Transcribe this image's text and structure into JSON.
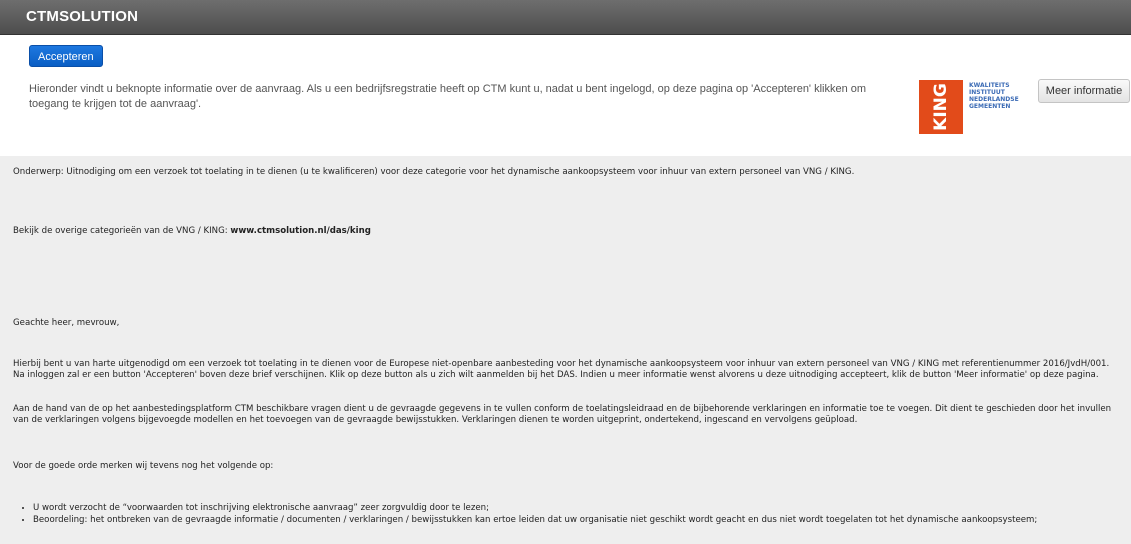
{
  "header": {
    "title": "CTMSOLUTION"
  },
  "toolbar": {
    "accept_label": "Accepteren",
    "more_info_label": "Meer informatie"
  },
  "intro_text": "Hieronder vindt u beknopte informatie over de aanvraag. Als u een bedrijfsregstratie heeft op CTM kunt u, nadat u bent ingelogd, op deze pagina op 'Accepteren' klikken om toegang te krijgen tot de aanvraag'.",
  "logo": {
    "letters": "KING",
    "lines": [
      "KWALITEITS",
      "INSTITUUT",
      "NEDERLANDSE",
      "GEMEENTEN"
    ],
    "color": "#e24b1a"
  },
  "letter": {
    "subject": "Onderwerp: Uitnodiging om een verzoek tot toelating in te dienen (u te kwalificeren) voor deze categorie voor het dynamische aankoopsysteem voor inhuur van extern personeel van VNG / KING.",
    "categories_prefix": "Bekijk de overige categorieën van de VNG / KING: ",
    "categories_link": "www.ctmsolution.nl/das/king",
    "greeting": "Geachte heer, mevrouw,",
    "para1": "Hierbij bent u van harte uitgenodigd om een verzoek tot toelating in te dienen voor de Europese niet-openbare aanbesteding voor het dynamische aankoopsysteem voor inhuur van extern personeel van VNG / KING met referentienummer 2016/JvdH/001. Na inloggen zal er een button 'Accepteren' boven deze brief verschijnen. Klik op deze button als u zich wilt aanmelden bij het DAS. Indien u meer informatie wenst alvorens u deze uitnodiging accepteert, klik de button 'Meer informatie' op deze pagina.",
    "para2": "Aan de hand van de op het aanbestedingsplatform CTM beschikbare vragen dient u de gevraagde gegevens in te vullen conform de toelatingsleidraad en de bijbehorende verklaringen en informatie toe te voegen. Dit dient te geschieden door het invullen van de verklaringen volgens bijgevoegde modellen en het toevoegen van de gevraagde bewijsstukken. Verklaringen dienen te worden uitgeprint, ondertekend, ingescand en vervolgens geüpload.",
    "para3": "Voor de goede orde merken wij tevens nog het volgende op:",
    "bullets": [
      "U wordt verzocht de “voorwaarden tot inschrijving elektronische aanvraag” zeer zorgvuldig door te lezen;",
      "Beoordeling: het ontbreken van de gevraagde informatie / documenten / verklaringen / bewijsstukken kan ertoe leiden dat uw organisatie niet geschikt wordt geacht en dus niet wordt toegelaten tot het dynamische aankoopsysteem;"
    ]
  }
}
